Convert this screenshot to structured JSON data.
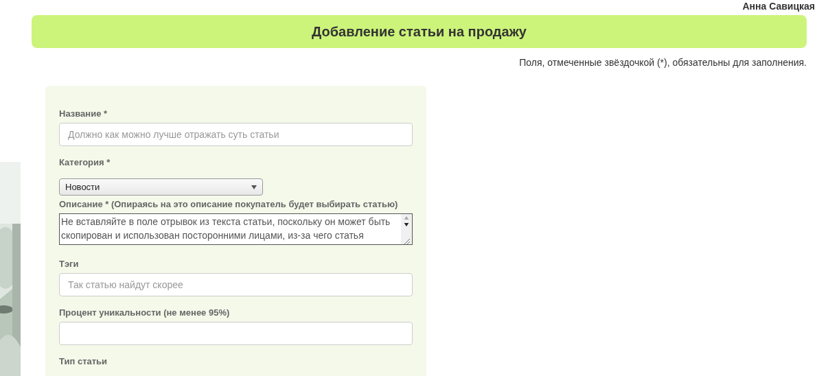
{
  "user_name": "Анна Савицкая",
  "header": {
    "title": "Добавление статьи на продажу"
  },
  "required_note": "Поля, отмеченные звёздочкой (*), обязательны для заполнения.",
  "form": {
    "fields": [
      {
        "kind": "text",
        "label": "Название *",
        "placeholder": "Должно как можно лучше отражать суть статьи"
      },
      {
        "kind": "select",
        "label": "Категория *",
        "value": "Новости"
      },
      {
        "kind": "textarea",
        "label": "Описание * (Опираясь на это описание покупатель будет выбирать статью)",
        "value": "Не вставляйте в поле отрывок из текста статьи, поскольку он может быть скопирован и использован посторонними лицами, из-за чего статья"
      },
      {
        "kind": "text",
        "label": "Тэги",
        "placeholder": "Так статью найдут скорее"
      },
      {
        "kind": "text",
        "label": "Процент уникальности (не менее 95%)"
      },
      {
        "kind": "label",
        "label": "Тип статьи"
      }
    ]
  }
}
